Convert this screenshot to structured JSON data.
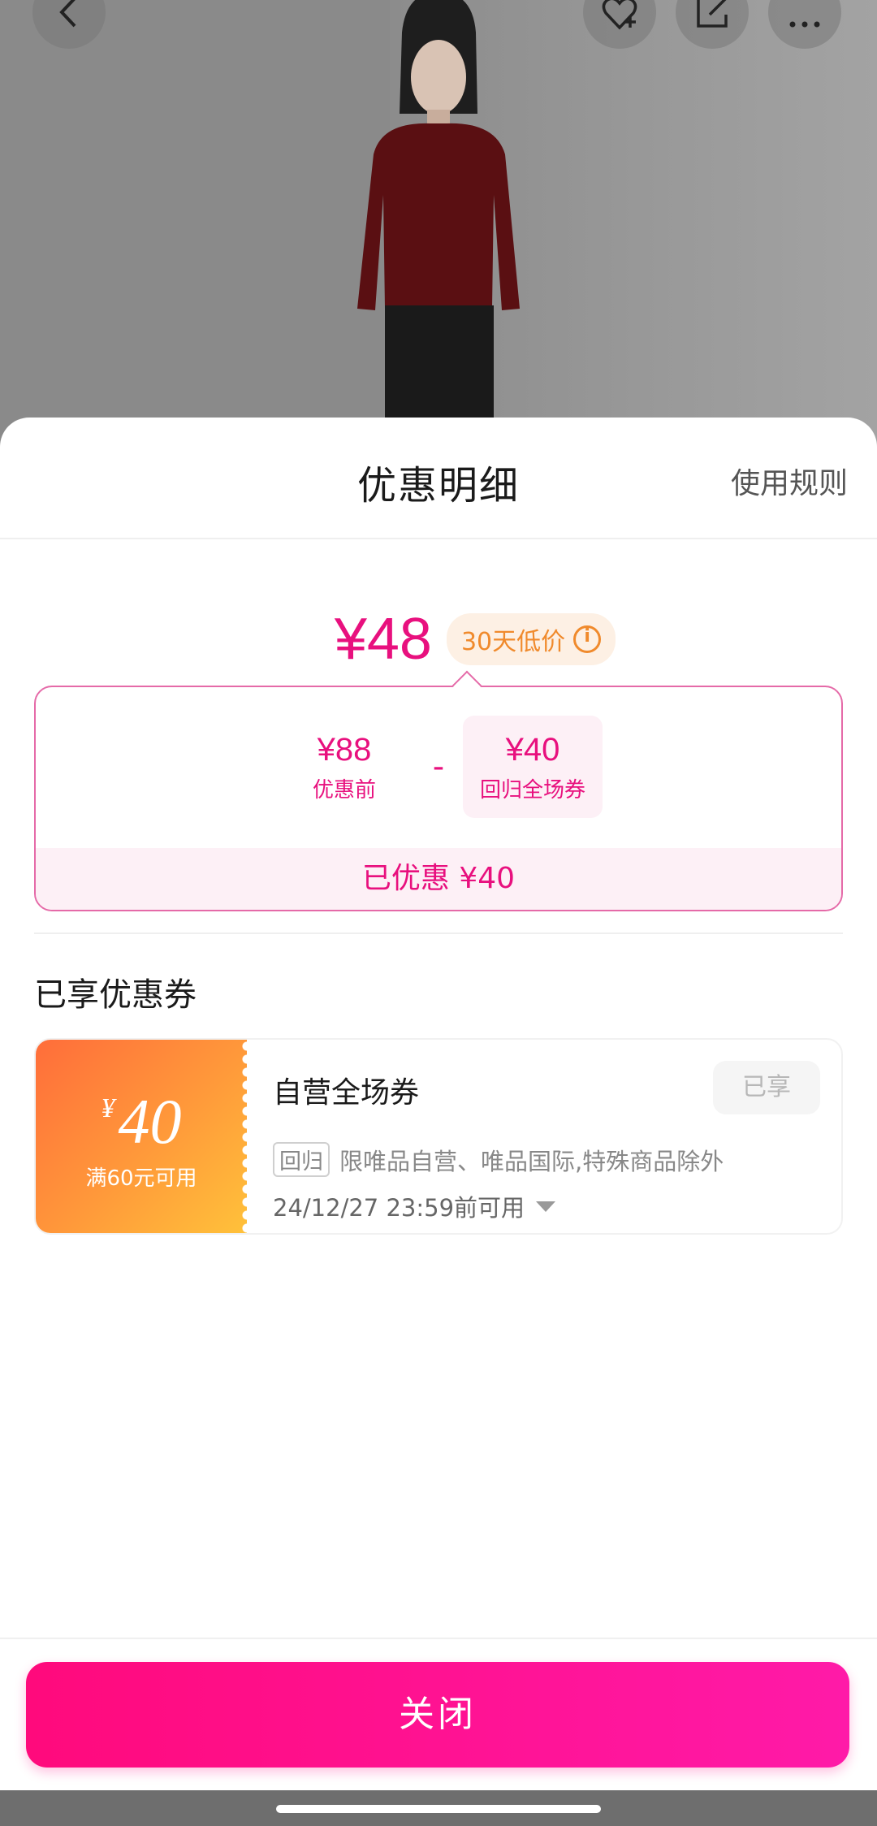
{
  "sheet": {
    "title": "优惠明细",
    "rules_link": "使用规则"
  },
  "price": {
    "final": "¥48",
    "low_badge": "30天低价"
  },
  "calc": {
    "original_price": "¥88",
    "original_label": "优惠前",
    "operator": "-",
    "coupon_value": "¥40",
    "coupon_label": "回归全场券",
    "saved_text": "已优惠 ¥40"
  },
  "applied_section": {
    "title": "已享优惠券"
  },
  "coupon": {
    "yen_symbol": "¥",
    "amount": "40",
    "condition": "满60元可用",
    "name": "自营全场券",
    "status_badge": "已享",
    "tag": "回归",
    "scope": "限唯品自营、唯品国际,特殊商品除外",
    "expiry": "24/12/27 23:59前可用"
  },
  "footer": {
    "close_label": "关闭"
  },
  "colors": {
    "accent": "#e8107e",
    "button": "#ff0a7c",
    "badge_orange": "#f08a2c",
    "coupon_gradient_start": "#ff6d3a",
    "coupon_gradient_end": "#ffc23a"
  },
  "icons": {
    "top_bar": [
      "back-icon",
      "heart-plus-icon",
      "share-icon",
      "more-icon"
    ],
    "info": "info-icon",
    "expand": "chevron-down-icon"
  }
}
